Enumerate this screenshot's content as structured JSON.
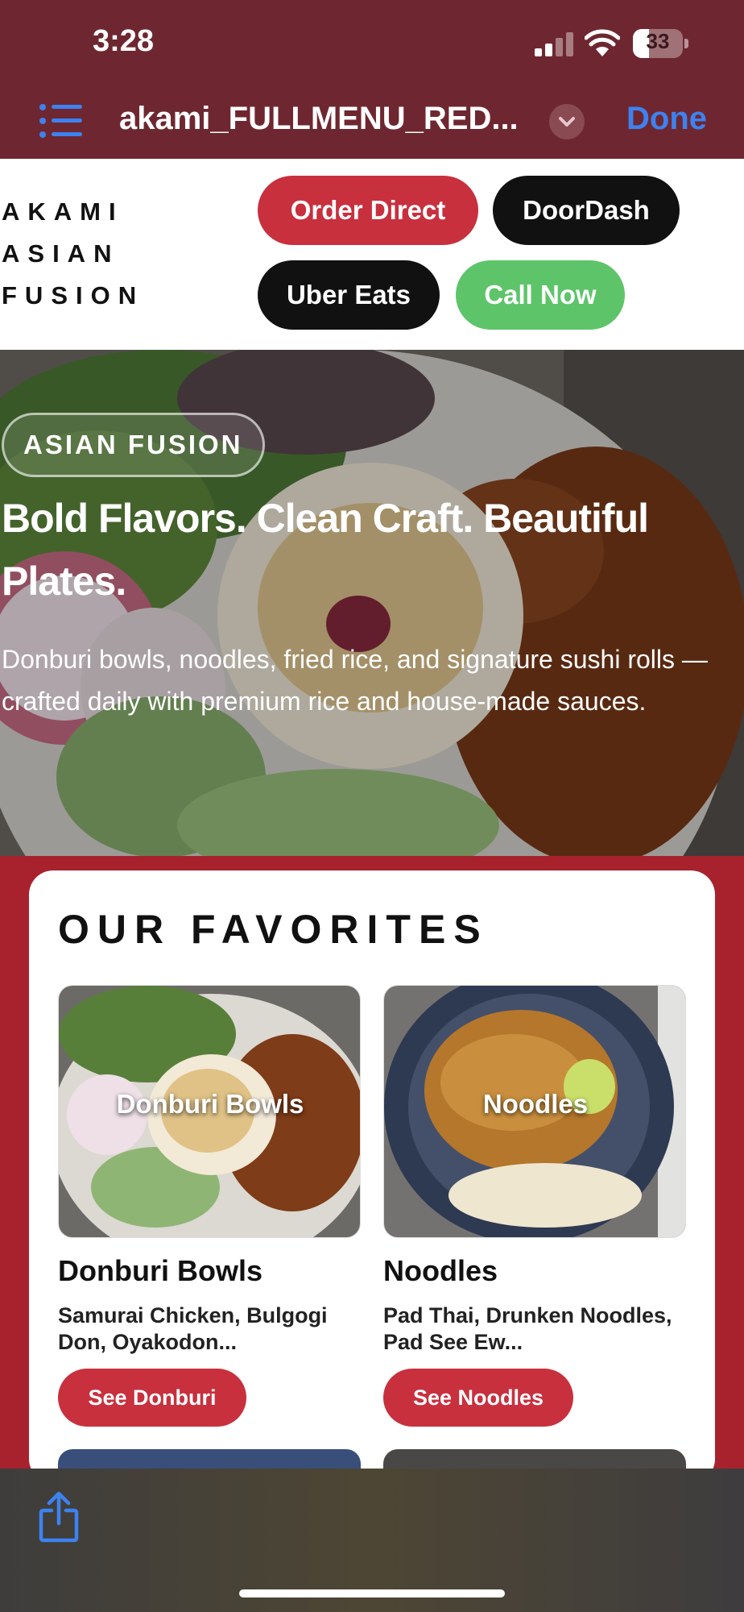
{
  "status_bar": {
    "time": "3:28",
    "battery": "33",
    "battery_level": 0.33
  },
  "nav": {
    "document_title": "akami_FULLMENU_RED...",
    "done_label": "Done"
  },
  "brand": {
    "logo_lines": [
      "AKAMI",
      "ASIAN",
      "FUSION"
    ]
  },
  "header_buttons": {
    "order_direct": "Order Direct",
    "doordash": "DoorDash",
    "uber_eats": "Uber Eats",
    "call_now": "Call Now"
  },
  "hero": {
    "tag": "ASIAN FUSION",
    "title": "Bold Flavors. Clean Craft. Beautiful Plates.",
    "description": "Donburi bowls, noodles, fried rice, and signature sushi rolls — crafted daily with premium rice and house-made sauces."
  },
  "favorites": {
    "heading": "OUR FAVORITES",
    "items": [
      {
        "overlay": "Donburi Bowls",
        "name": "Donburi Bowls",
        "description": "Samurai Chicken, Bulgogi Don, Oyakodon...",
        "button": "See Donburi"
      },
      {
        "overlay": "Noodles",
        "name": "Noodles",
        "description": "Pad Thai, Drunken Noodles, Pad See Ew...",
        "button": "See Noodles"
      }
    ]
  },
  "colors": {
    "toolbar_bg": "#6e2730",
    "brand_red": "#c8303e",
    "call_green": "#5ec46a",
    "link_blue": "#3d82f0",
    "section_red": "#a8222e"
  }
}
